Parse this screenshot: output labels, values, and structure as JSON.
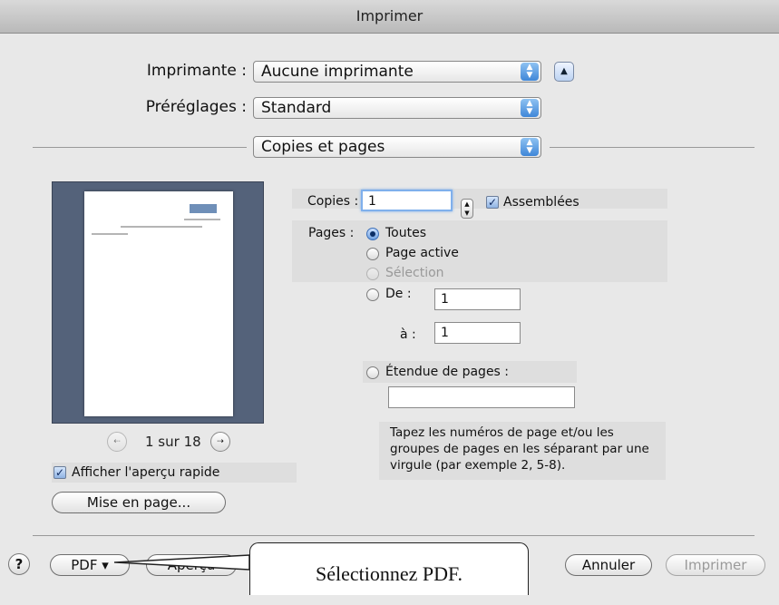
{
  "window": {
    "title": "Imprimer"
  },
  "printer": {
    "label": "Imprimante :",
    "value": "Aucune imprimante"
  },
  "presets": {
    "label": "Préréglages :",
    "value": "Standard"
  },
  "section": {
    "value": "Copies et pages"
  },
  "preview": {
    "page_info": "1 sur 18"
  },
  "quick_preview": {
    "label": "Afficher l'aperçu rapide",
    "checked": true
  },
  "page_setup": {
    "label": "Mise en page..."
  },
  "copies": {
    "label": "Copies :",
    "value": "1",
    "collate_label": "Assemblées",
    "collate_checked": true
  },
  "pages": {
    "label": "Pages :",
    "options": {
      "all": "Toutes",
      "current": "Page active",
      "selection": "Sélection",
      "from": "De :"
    },
    "selected": "all",
    "from_value": "1",
    "to_label": "à :",
    "to_value": "1",
    "range_label": "Étendue de pages :",
    "range_value": "",
    "hint": "Tapez les numéros de page et/ou les groupes de pages en les séparant par une virgule (par exemple 2, 5-8)."
  },
  "footer": {
    "help": "?",
    "pdf": "PDF ▾",
    "preview": "Aperçu",
    "cancel": "Annuler",
    "print": "Imprimer"
  },
  "annotation": {
    "text": "Sélectionnez PDF."
  },
  "colors": {
    "accent": "#3f86d8",
    "preview_bg": "#54627a"
  }
}
